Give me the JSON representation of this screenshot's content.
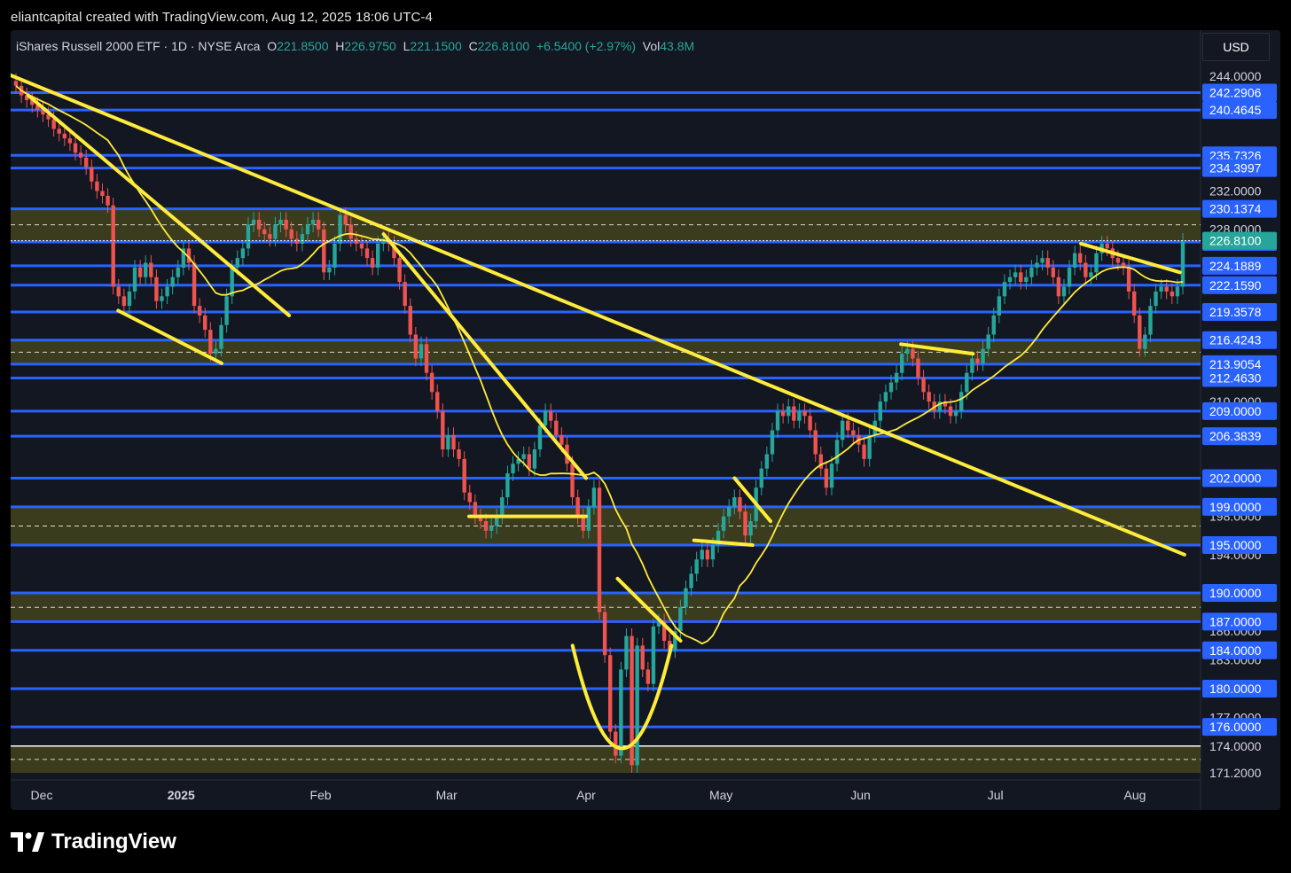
{
  "header": {
    "title": "eliantcapital created with TradingView.com, Aug 12, 2025 18:06 UTC-4"
  },
  "legend": {
    "symbol": "iShares Russell 2000 ETF · 1D · NYSE Arca",
    "open_label": "O",
    "open": "221.8500",
    "high_label": "H",
    "high": "226.9750",
    "low_label": "L",
    "low": "221.1500",
    "close_label": "C",
    "close": "226.8100",
    "change": "+6.5400 (+2.97%)",
    "vol_label": "Vol",
    "vol": "43.8M"
  },
  "currency_button": "USD",
  "brand": "TradingView",
  "colors": {
    "background": "#131722",
    "up": "#26a69a",
    "down": "#ef5350",
    "level_line": "#2962ff",
    "trendline": "#ffeb3b",
    "zone_fill": "#4a4a1e",
    "last_price": "#26a69a"
  },
  "chart_data": {
    "type": "candlestick",
    "title": "",
    "ylim": [
      171.2,
      246
    ],
    "price_scale_labels": [
      "244.0000",
      "232.0000",
      "228.0000",
      "210.0000",
      "198.0000",
      "194.0000",
      "186.0000",
      "183.0000",
      "177.0000",
      "174.0000",
      "171.2000"
    ],
    "x_tick_labels": [
      {
        "label": "Dec",
        "date": "2024-12-01"
      },
      {
        "label": "2025",
        "date": "2025-01-01"
      },
      {
        "label": "Feb",
        "date": "2025-02-01"
      },
      {
        "label": "Mar",
        "date": "2025-03-01"
      },
      {
        "label": "Apr",
        "date": "2025-04-01"
      },
      {
        "label": "May",
        "date": "2025-05-01"
      },
      {
        "label": "Jun",
        "date": "2025-06-01"
      },
      {
        "label": "Jul",
        "date": "2025-07-01"
      },
      {
        "label": "Aug",
        "date": "2025-08-01"
      }
    ],
    "horizontal_levels": [
      {
        "label": "242.2906",
        "value": 242.2906
      },
      {
        "label": "240.4645",
        "value": 240.4645
      },
      {
        "label": "235.7326",
        "value": 235.7326
      },
      {
        "label": "234.3997",
        "value": 234.3997
      },
      {
        "label": "230.1374",
        "value": 230.1374
      },
      {
        "label": "226.6801",
        "value": 226.6801
      },
      {
        "label": "224.1889",
        "value": 224.1889
      },
      {
        "label": "222.1590",
        "value": 222.159
      },
      {
        "label": "219.3578",
        "value": 219.3578
      },
      {
        "label": "216.4243",
        "value": 216.4243
      },
      {
        "label": "213.9054",
        "value": 213.9054
      },
      {
        "label": "212.4630",
        "value": 212.463
      },
      {
        "label": "209.0000",
        "value": 209.0
      },
      {
        "label": "206.3839",
        "value": 206.3839
      },
      {
        "label": "202.0000",
        "value": 202.0
      },
      {
        "label": "199.0000",
        "value": 199.0
      },
      {
        "label": "195.0000",
        "value": 195.0
      },
      {
        "label": "190.0000",
        "value": 190.0
      },
      {
        "label": "187.0000",
        "value": 187.0
      },
      {
        "label": "184.0000",
        "value": 184.0
      },
      {
        "label": "180.0000",
        "value": 180.0
      },
      {
        "label": "176.0000",
        "value": 176.0
      }
    ],
    "last_price": {
      "label": "226.8100",
      "value": 226.81
    },
    "zones": [
      {
        "top": 230.1374,
        "bottom": 226.81
      },
      {
        "top": 216.4243,
        "bottom": 213.9054
      },
      {
        "top": 199.0,
        "bottom": 195.0
      },
      {
        "top": 190.0,
        "bottom": 187.0
      },
      {
        "top": 174.0,
        "bottom": 171.2
      }
    ],
    "candles_close": [
      243.0,
      242.0,
      241.5,
      241.0,
      240.5,
      240.0,
      239.5,
      238.5,
      238.0,
      237.5,
      237.0,
      236.0,
      235.5,
      234.5,
      233.0,
      232.0,
      231.5,
      230.5,
      222.0,
      221.0,
      220.0,
      221.5,
      224.0,
      223.0,
      224.5,
      223.0,
      220.5,
      221.0,
      222.0,
      223.0,
      224.0,
      226.0,
      224.5,
      220.0,
      219.0,
      217.5,
      215.0,
      215.5,
      218.0,
      221.0,
      224.0,
      225.0,
      226.0,
      228.5,
      229.0,
      228.0,
      227.5,
      227.0,
      228.5,
      229.0,
      228.0,
      227.0,
      226.5,
      227.5,
      228.5,
      229.0,
      228.0,
      223.5,
      224.0,
      226.5,
      229.5,
      228.5,
      227.0,
      226.5,
      226.0,
      225.0,
      224.0,
      226.5,
      227.0,
      226.5,
      225.0,
      222.5,
      220.0,
      217.0,
      214.5,
      216.0,
      213.0,
      211.0,
      209.0,
      205.0,
      206.5,
      205.0,
      204.0,
      200.5,
      199.5,
      198.0,
      197.5,
      196.5,
      197.0,
      198.0,
      200.0,
      202.5,
      203.5,
      204.0,
      204.5,
      203.0,
      205.0,
      207.5,
      209.0,
      208.0,
      206.5,
      205.5,
      203.5,
      200.0,
      198.0,
      196.5,
      199.0,
      201.0,
      188.0,
      183.5,
      175.5,
      173.0,
      182.0,
      185.5,
      172.0,
      184.5,
      182.0,
      180.5,
      186.5,
      187.0,
      185.0,
      184.0,
      186.0,
      188.5,
      190.5,
      192.0,
      193.5,
      194.5,
      193.5,
      195.0,
      196.5,
      198.0,
      199.0,
      200.0,
      198.5,
      196.0,
      197.5,
      201.0,
      203.0,
      204.5,
      207.0,
      209.0,
      208.5,
      209.5,
      208.0,
      209.0,
      208.5,
      207.0,
      204.5,
      203.0,
      201.0,
      203.5,
      206.0,
      208.0,
      207.0,
      206.5,
      205.5,
      204.0,
      206.5,
      208.0,
      210.0,
      211.0,
      212.0,
      213.0,
      215.0,
      215.5,
      214.5,
      212.5,
      211.0,
      210.0,
      209.0,
      210.0,
      209.5,
      208.5,
      209.0,
      211.0,
      213.0,
      214.5,
      214.0,
      215.5,
      217.0,
      219.0,
      221.0,
      222.5,
      223.0,
      223.5,
      222.5,
      223.0,
      224.0,
      224.5,
      225.0,
      224.0,
      223.0,
      221.0,
      222.0,
      224.0,
      225.5,
      224.5,
      223.0,
      223.5,
      225.5,
      226.5,
      226.0,
      225.0,
      224.5,
      224.0,
      221.5,
      219.0,
      215.5,
      217.0,
      220.0,
      221.5,
      222.0,
      221.5,
      221.0,
      222.0,
      226.81
    ],
    "trendlines": [
      {
        "from": [
          "2024-11-22",
          244.5
        ],
        "to": [
          "2025-08-12",
          194.0
        ]
      },
      {
        "from": [
          "2024-11-28",
          242.0
        ],
        "to": [
          "2025-01-25",
          219.0
        ]
      },
      {
        "from": [
          "2024-12-18",
          219.5
        ],
        "to": [
          "2025-01-10",
          214.0
        ]
      },
      {
        "from": [
          "2025-02-15",
          227.5
        ],
        "to": [
          "2025-04-01",
          202.0
        ]
      },
      {
        "from": [
          "2025-03-06",
          198.0
        ],
        "to": [
          "2025-04-01",
          198.0
        ]
      },
      {
        "from": [
          "2025-04-08",
          191.5
        ],
        "to": [
          "2025-04-22",
          185.0
        ]
      },
      {
        "from": [
          "2025-04-25",
          195.5
        ],
        "to": [
          "2025-05-08",
          195.0
        ]
      },
      {
        "from": [
          "2025-05-04",
          202.0
        ],
        "to": [
          "2025-05-12",
          197.5
        ]
      },
      {
        "from": [
          "2025-06-10",
          216.0
        ],
        "to": [
          "2025-06-26",
          215.0
        ]
      },
      {
        "from": [
          "2025-07-20",
          226.5
        ],
        "to": [
          "2025-08-11",
          223.5
        ]
      }
    ]
  }
}
